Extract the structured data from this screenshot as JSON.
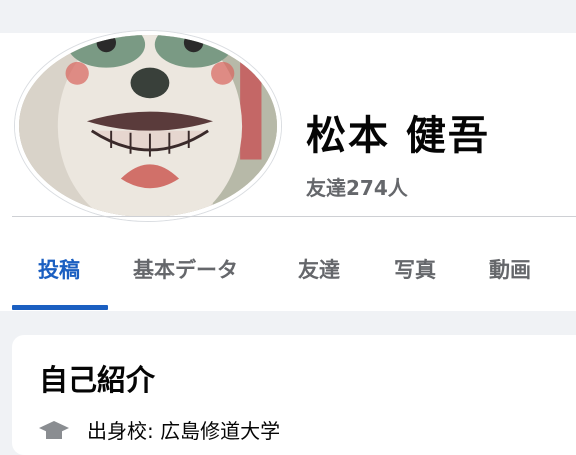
{
  "profile": {
    "name": "松本 健吾",
    "friends_count": "友達274人"
  },
  "tabs": [
    {
      "label": "投稿",
      "active": true
    },
    {
      "label": "基本データ",
      "active": false
    },
    {
      "label": "友達",
      "active": false
    },
    {
      "label": "写真",
      "active": false
    },
    {
      "label": "動画",
      "active": false
    }
  ],
  "intro": {
    "title": "自己紹介",
    "education": "出身校: 広島修道大学"
  },
  "colors": {
    "accent": "#1b5fc1",
    "text_primary": "#050505",
    "text_secondary": "#65676b",
    "background": "#f0f2f5"
  }
}
